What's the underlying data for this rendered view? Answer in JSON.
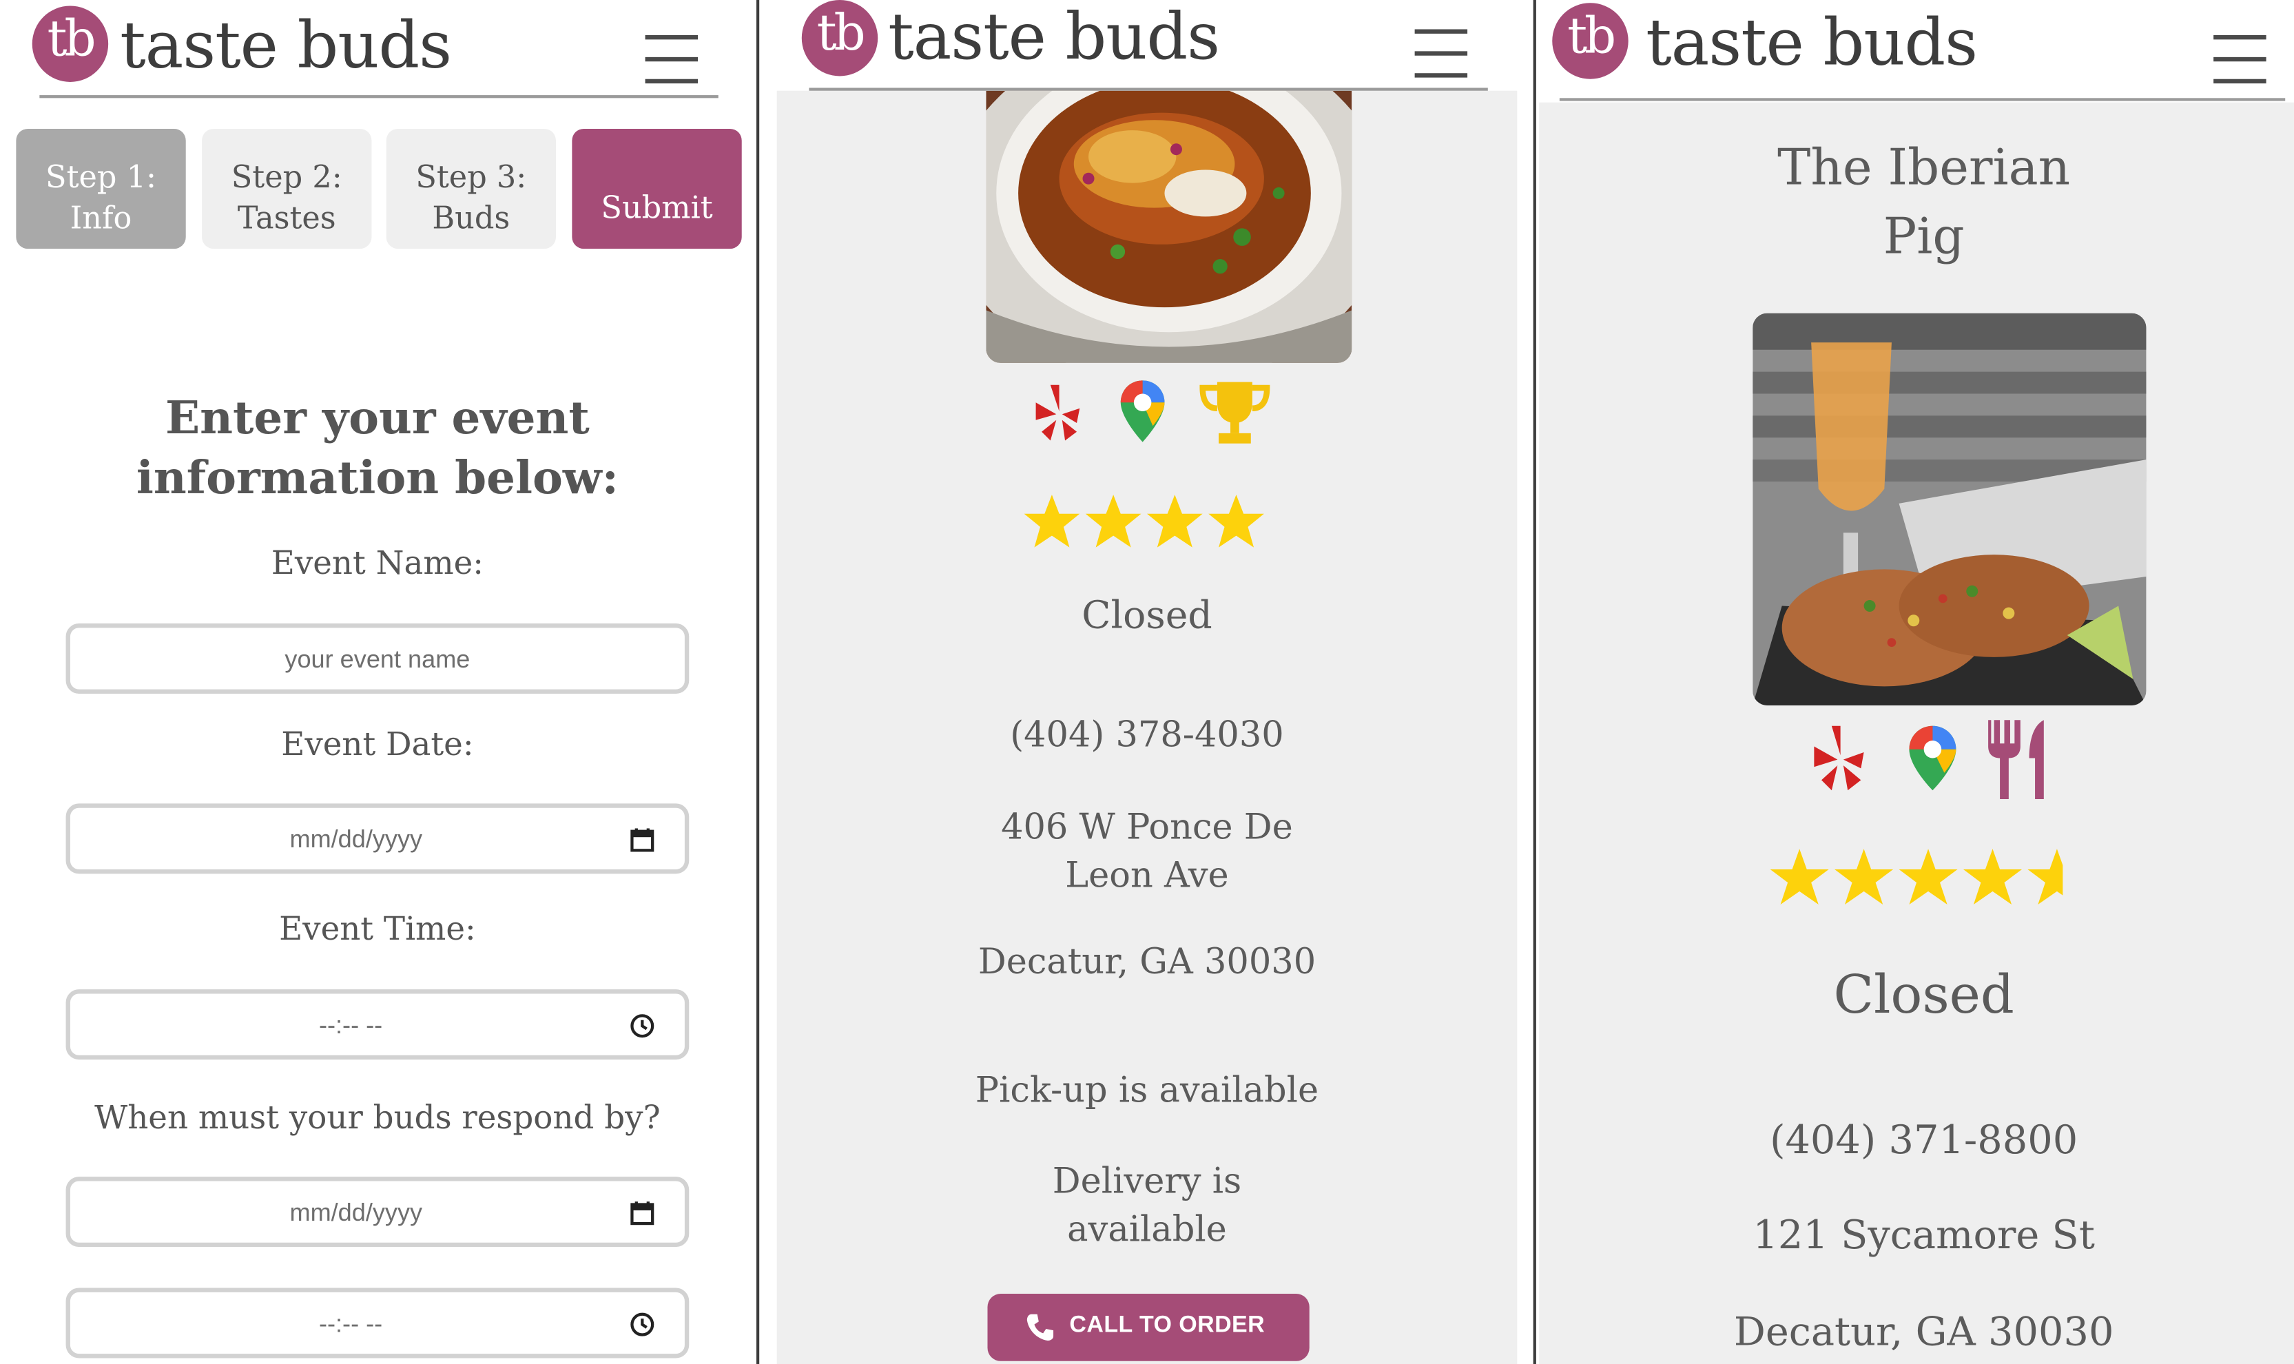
{
  "brand": {
    "initials": "tb",
    "name": "taste buds",
    "accent_color": "#a54c77"
  },
  "panel1": {
    "steps": [
      {
        "label": "Step 1:\nInfo",
        "state": "active"
      },
      {
        "label": "Step 2:\nTastes",
        "state": "inactive"
      },
      {
        "label": "Step 3:\nBuds",
        "state": "inactive"
      },
      {
        "label": "Submit",
        "state": "primary"
      }
    ],
    "heading": "Enter your event information below:",
    "fields": {
      "event_name_label": "Event Name:",
      "event_name_placeholder": "your event name",
      "event_date_label": "Event Date:",
      "event_date_placeholder": "mm/dd/yyyy",
      "event_time_label": "Event Time:",
      "event_time_placeholder": "--:-- --",
      "respond_by_label": "When must your buds respond by?",
      "respond_date_placeholder": "mm/dd/yyyy",
      "respond_time_placeholder": "--:-- --"
    }
  },
  "panel2": {
    "source_icons": [
      "yelp-icon",
      "google-maps-icon",
      "trophy-icon"
    ],
    "rating": 4,
    "status": "Closed",
    "phone": "(404) 378-4030",
    "address_line1": "406 W Ponce De Leon Ave",
    "address_line2": "Decatur, GA 30030",
    "pickup": "Pick-up is available",
    "delivery": "Delivery is available",
    "call_button": "CALL TO ORDER"
  },
  "panel3": {
    "restaurant_name": "The Iberian Pig",
    "source_icons": [
      "yelp-icon",
      "google-maps-icon",
      "fork-knife-icon"
    ],
    "rating": 4.5,
    "status": "Closed",
    "phone": "(404) 371-8800",
    "address_line1": "121 Sycamore St",
    "address_line2": "Decatur, GA 30030"
  }
}
